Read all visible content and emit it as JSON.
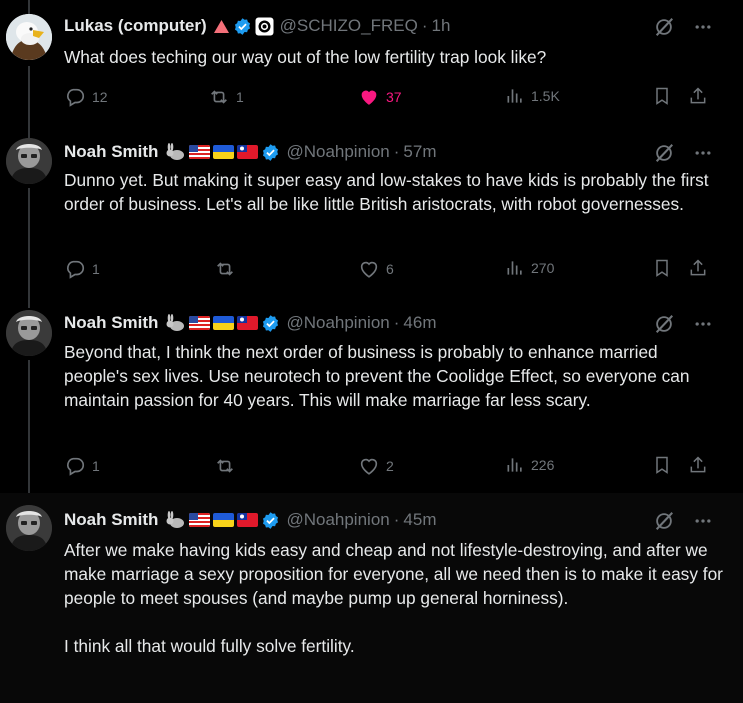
{
  "tweets": [
    {
      "name": "Lukas (computer)",
      "handle": "@SCHIZO_FREQ",
      "time": "1h",
      "text": "What does teching our way out of the low fertility trap look like?",
      "replies": "12",
      "retweets": "1",
      "likes": "37",
      "views": "1.5K",
      "liked": true
    },
    {
      "name": "Noah Smith",
      "handle": "@Noahpinion",
      "time": "57m",
      "text": "Dunno yet. But making it super easy and low-stakes to have kids is probably the first order of business. Let's all be like little British aristocrats, with robot governesses.",
      "replies": "1",
      "retweets": "",
      "likes": "6",
      "views": "270",
      "liked": false
    },
    {
      "name": "Noah Smith",
      "handle": "@Noahpinion",
      "time": "46m",
      "text": "Beyond that, I think the next order of business is probably to enhance married people's sex lives. Use neurotech to prevent the Coolidge Effect, so everyone can maintain passion for 40 years. This will make marriage far less scary.",
      "replies": "1",
      "retweets": "",
      "likes": "2",
      "views": "226",
      "liked": false
    },
    {
      "name": "Noah Smith",
      "handle": "@Noahpinion",
      "time": "45m",
      "text": "After we make having kids easy and cheap and not lifestyle-destroying, and after we make marriage a sexy proposition for everyone, all we need then is to make it easy for people to meet spouses (and maybe pump up general horniness).\n\nI think all that would fully solve fertility."
    }
  ],
  "separator": "·",
  "icons": [
    "reply-icon",
    "retweet-icon",
    "like-icon",
    "views-icon",
    "bookmark-icon",
    "share-icon",
    "grok-icon",
    "more-icon",
    "verified-badge-icon",
    "rabbit-emoji",
    "us-flag",
    "ukraine-flag",
    "taiwan-flag"
  ],
  "colors": {
    "background": "#000000",
    "text": "#e7e9ea",
    "muted": "#71767b",
    "like": "#f91880",
    "verified": "#1d9bf0"
  }
}
